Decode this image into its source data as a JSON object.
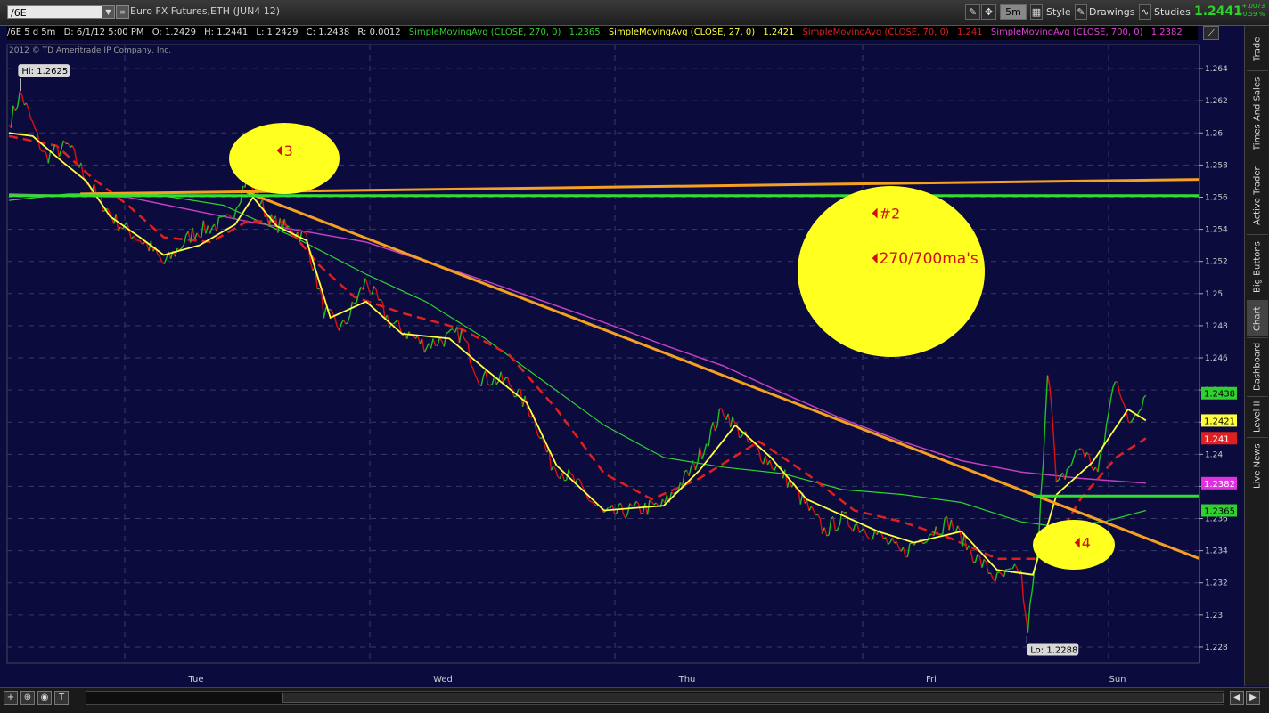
{
  "toolbar": {
    "symbol": "/6E",
    "title": "Euro FX Futures,ETH (JUN4 12)",
    "timeframe": "5m",
    "style_label": "Style",
    "drawings_label": "Drawings",
    "studies_label": "Studies",
    "last_price": "1.2441",
    "change": "+.0073",
    "change_pct": "+0.59 %"
  },
  "infobar": {
    "period": "/6E 5 d 5m",
    "date": "D: 6/1/12 5:00 PM",
    "open": "O: 1.2429",
    "high": "H: 1.2441",
    "low": "L: 1.2429",
    "close": "C: 1.2438",
    "range": "R: 0.0012",
    "sma270_label": "SimpleMovingAvg (CLOSE, 270, 0)",
    "sma270_value": "1.2365",
    "sma27_label": "SimpleMovingAvg (CLOSE, 27, 0)",
    "sma27_value": "1.2421",
    "sma70_label": "SimpleMovingAvg (CLOSE, 70, 0)",
    "sma70_value": "1.241",
    "sma700_label": "SimpleMovingAvg (CLOSE, 700, 0)",
    "sma700_value": "1.2382"
  },
  "copyright": "2012 © TD Ameritrade IP Company, Inc.",
  "colors": {
    "background": "#0b0b3d",
    "up": "#22c022",
    "down": "#e01010",
    "sma27": "#ffff40",
    "sma70": "#e02020",
    "sma270": "#30d030",
    "sma700": "#c040c0",
    "trendline": "#f5a020",
    "hline": "#30e030",
    "highlight": "#ffff20",
    "annotation_text": "#d01010"
  },
  "right_tabs": [
    "Trade",
    "Times And Sales",
    "Active Trader",
    "Big Buttons",
    "Chart",
    "Dashboard",
    "Level II",
    "Live News"
  ],
  "active_tab": "Chart",
  "chart_data": {
    "type": "line",
    "x_tick_labels": [
      "Tue",
      "Wed",
      "Thu",
      "Fri",
      "Sun"
    ],
    "y_ticks": [
      1.228,
      1.23,
      1.232,
      1.234,
      1.236,
      1.238,
      1.24,
      1.242,
      1.244,
      1.246,
      1.248,
      1.25,
      1.252,
      1.254,
      1.256,
      1.258,
      1.26,
      1.262,
      1.264
    ],
    "y_tick_labels": [
      "1.228",
      "1.23",
      "1.232",
      "1.234",
      "1.236",
      "1.238",
      "1.24",
      "1.242",
      "1.244",
      "1.246",
      "1.248",
      "1.25",
      "1.252",
      "1.254",
      "1.256",
      "1.258",
      "1.26",
      "1.262",
      "1.264"
    ],
    "ylim": [
      1.227,
      1.2655
    ],
    "grid": true,
    "high_label": "Hi: 1.2625",
    "low_label": "Lo: 1.2288",
    "price_points": [
      [
        0.0,
        1.2605
      ],
      [
        0.01,
        1.2625
      ],
      [
        0.03,
        1.2585
      ],
      [
        0.05,
        1.2592
      ],
      [
        0.07,
        1.2565
      ],
      [
        0.09,
        1.2545
      ],
      [
        0.12,
        1.2528
      ],
      [
        0.13,
        1.2518
      ],
      [
        0.155,
        1.2538
      ],
      [
        0.185,
        1.2545
      ],
      [
        0.2,
        1.2572
      ],
      [
        0.22,
        1.2545
      ],
      [
        0.25,
        1.2535
      ],
      [
        0.265,
        1.2488
      ],
      [
        0.28,
        1.2478
      ],
      [
        0.3,
        1.2508
      ],
      [
        0.32,
        1.2482
      ],
      [
        0.35,
        1.2468
      ],
      [
        0.38,
        1.2475
      ],
      [
        0.395,
        1.2448
      ],
      [
        0.42,
        1.2445
      ],
      [
        0.44,
        1.2425
      ],
      [
        0.455,
        1.2395
      ],
      [
        0.475,
        1.2383
      ],
      [
        0.5,
        1.2362
      ],
      [
        0.52,
        1.2365
      ],
      [
        0.55,
        1.2368
      ],
      [
        0.575,
        1.2392
      ],
      [
        0.6,
        1.2428
      ],
      [
        0.62,
        1.2408
      ],
      [
        0.65,
        1.2388
      ],
      [
        0.67,
        1.2368
      ],
      [
        0.685,
        1.2352
      ],
      [
        0.7,
        1.236
      ],
      [
        0.73,
        1.235
      ],
      [
        0.75,
        1.2338
      ],
      [
        0.77,
        1.235
      ],
      [
        0.79,
        1.2358
      ],
      [
        0.81,
        1.2338
      ],
      [
        0.83,
        1.2322
      ],
      [
        0.85,
        1.2328
      ],
      [
        0.855,
        1.2288
      ],
      [
        0.865,
        1.2345
      ],
      [
        0.873,
        1.2462
      ],
      [
        0.88,
        1.2378
      ],
      [
        0.9,
        1.2405
      ],
      [
        0.915,
        1.2388
      ],
      [
        0.93,
        1.2452
      ],
      [
        0.94,
        1.2418
      ],
      [
        0.955,
        1.2438
      ]
    ],
    "sma27_points": [
      [
        0.0,
        1.26
      ],
      [
        0.02,
        1.2598
      ],
      [
        0.045,
        1.2582
      ],
      [
        0.065,
        1.257
      ],
      [
        0.085,
        1.2548
      ],
      [
        0.11,
        1.2535
      ],
      [
        0.13,
        1.2524
      ],
      [
        0.16,
        1.253
      ],
      [
        0.19,
        1.2543
      ],
      [
        0.205,
        1.256
      ],
      [
        0.225,
        1.2542
      ],
      [
        0.25,
        1.2533
      ],
      [
        0.27,
        1.2485
      ],
      [
        0.3,
        1.2495
      ],
      [
        0.33,
        1.2475
      ],
      [
        0.37,
        1.2472
      ],
      [
        0.4,
        1.2453
      ],
      [
        0.435,
        1.2432
      ],
      [
        0.46,
        1.2393
      ],
      [
        0.5,
        1.2365
      ],
      [
        0.55,
        1.2368
      ],
      [
        0.58,
        1.239
      ],
      [
        0.61,
        1.2418
      ],
      [
        0.64,
        1.2398
      ],
      [
        0.67,
        1.2372
      ],
      [
        0.7,
        1.2362
      ],
      [
        0.73,
        1.2352
      ],
      [
        0.76,
        1.2345
      ],
      [
        0.8,
        1.2352
      ],
      [
        0.83,
        1.2328
      ],
      [
        0.86,
        1.2325
      ],
      [
        0.88,
        1.2375
      ],
      [
        0.91,
        1.2395
      ],
      [
        0.94,
        1.2428
      ],
      [
        0.955,
        1.2421
      ]
    ],
    "sma70_points": [
      [
        0.0,
        1.2598
      ],
      [
        0.04,
        1.2592
      ],
      [
        0.07,
        1.2572
      ],
      [
        0.1,
        1.2555
      ],
      [
        0.13,
        1.2535
      ],
      [
        0.17,
        1.2532
      ],
      [
        0.2,
        1.2545
      ],
      [
        0.23,
        1.2545
      ],
      [
        0.26,
        1.2518
      ],
      [
        0.29,
        1.2498
      ],
      [
        0.33,
        1.2488
      ],
      [
        0.38,
        1.2478
      ],
      [
        0.42,
        1.2462
      ],
      [
        0.46,
        1.2428
      ],
      [
        0.5,
        1.2388
      ],
      [
        0.54,
        1.2372
      ],
      [
        0.58,
        1.2385
      ],
      [
        0.63,
        1.2408
      ],
      [
        0.67,
        1.2388
      ],
      [
        0.71,
        1.2365
      ],
      [
        0.75,
        1.2358
      ],
      [
        0.79,
        1.2348
      ],
      [
        0.83,
        1.2335
      ],
      [
        0.87,
        1.2335
      ],
      [
        0.9,
        1.2372
      ],
      [
        0.93,
        1.2398
      ],
      [
        0.955,
        1.241
      ]
    ],
    "sma270_points": [
      [
        0.0,
        1.2558
      ],
      [
        0.05,
        1.2562
      ],
      [
        0.12,
        1.2562
      ],
      [
        0.18,
        1.2555
      ],
      [
        0.24,
        1.2535
      ],
      [
        0.3,
        1.2512
      ],
      [
        0.35,
        1.2495
      ],
      [
        0.4,
        1.2472
      ],
      [
        0.45,
        1.2445
      ],
      [
        0.5,
        1.2418
      ],
      [
        0.55,
        1.2398
      ],
      [
        0.6,
        1.2392
      ],
      [
        0.65,
        1.2388
      ],
      [
        0.7,
        1.2378
      ],
      [
        0.75,
        1.2375
      ],
      [
        0.8,
        1.237
      ],
      [
        0.85,
        1.2358
      ],
      [
        0.88,
        1.2355
      ],
      [
        0.92,
        1.2358
      ],
      [
        0.955,
        1.2365
      ]
    ],
    "sma700_points": [
      [
        0.0,
        1.2562
      ],
      [
        0.1,
        1.256
      ],
      [
        0.2,
        1.2545
      ],
      [
        0.3,
        1.2532
      ],
      [
        0.4,
        1.2508
      ],
      [
        0.5,
        1.2482
      ],
      [
        0.55,
        1.2468
      ],
      [
        0.6,
        1.2455
      ],
      [
        0.65,
        1.2438
      ],
      [
        0.7,
        1.2422
      ],
      [
        0.75,
        1.2408
      ],
      [
        0.8,
        1.2396
      ],
      [
        0.85,
        1.2389
      ],
      [
        0.9,
        1.2385
      ],
      [
        0.955,
        1.2382
      ]
    ],
    "trendlines": [
      {
        "name": "upper",
        "points": [
          [
            0.06,
            1.2562
          ],
          [
            1.0,
            1.2571
          ]
        ]
      },
      {
        "name": "downtrend",
        "points": [
          [
            0.2,
            1.2563
          ],
          [
            1.0,
            1.2335
          ]
        ]
      },
      {
        "name": "support-270",
        "points": [
          [
            0.0,
            1.2561
          ],
          [
            1.0,
            1.2561
          ]
        ]
      },
      {
        "name": "support-right",
        "points": [
          [
            0.86,
            1.2374
          ],
          [
            1.0,
            1.2374
          ]
        ]
      }
    ],
    "price_tags": [
      {
        "value": 1.2438,
        "label": "1.2438",
        "color": "#30d030",
        "text_color": "#000"
      },
      {
        "value": 1.2421,
        "label": "1.2421",
        "color": "#ffff40",
        "text_color": "#000"
      },
      {
        "value": 1.241,
        "label": "1.241",
        "color": "#e02020",
        "text_color": "#fff"
      },
      {
        "value": 1.2382,
        "label": "1.2382",
        "color": "#e030e0",
        "text_color": "#fff"
      },
      {
        "value": 1.2365,
        "label": "1.2365",
        "color": "#30d030",
        "text_color": "#000"
      }
    ],
    "annotations": [
      {
        "text": "3",
        "x": 0.225,
        "y": 1.2589
      },
      {
        "text": "#2",
        "x": 0.725,
        "y": 1.255
      },
      {
        "text": "270/700ma's",
        "x": 0.725,
        "y": 1.2522
      },
      {
        "text": "4",
        "x": 0.895,
        "y": 1.2345
      }
    ]
  }
}
